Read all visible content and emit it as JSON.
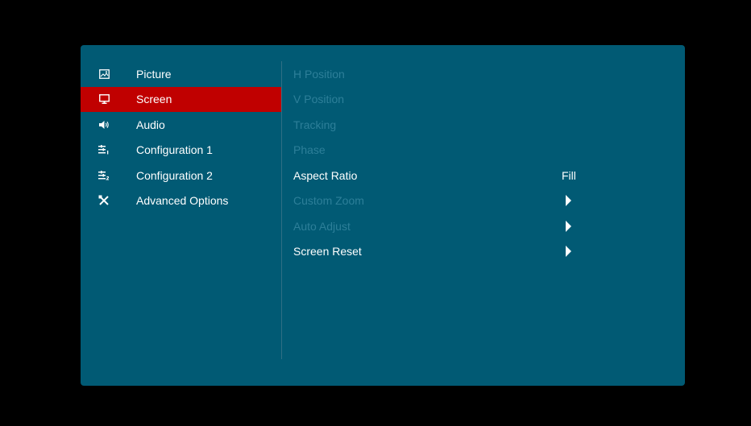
{
  "sidebar": {
    "items": [
      {
        "label": "Picture",
        "icon": "picture-icon",
        "active": false
      },
      {
        "label": "Screen",
        "icon": "monitor-icon",
        "active": true
      },
      {
        "label": "Audio",
        "icon": "speaker-icon",
        "active": false
      },
      {
        "label": "Configuration 1",
        "icon": "config-1-icon",
        "active": false
      },
      {
        "label": "Configuration 2",
        "icon": "config-2-icon",
        "active": false
      },
      {
        "label": "Advanced Options",
        "icon": "tools-icon",
        "active": false
      }
    ]
  },
  "screen_menu": {
    "rows": [
      {
        "label": "H Position",
        "enabled": false,
        "value": "",
        "has_arrow": false
      },
      {
        "label": "V Position",
        "enabled": false,
        "value": "",
        "has_arrow": false
      },
      {
        "label": "Tracking",
        "enabled": false,
        "value": "",
        "has_arrow": false
      },
      {
        "label": "Phase",
        "enabled": false,
        "value": "",
        "has_arrow": false
      },
      {
        "label": "Aspect Ratio",
        "enabled": true,
        "value": "Fill",
        "has_arrow": false
      },
      {
        "label": "Custom Zoom",
        "enabled": false,
        "value": "",
        "has_arrow": true
      },
      {
        "label": "Auto Adjust",
        "enabled": false,
        "value": "",
        "has_arrow": true
      },
      {
        "label": "Screen Reset",
        "enabled": true,
        "value": "",
        "has_arrow": true
      }
    ]
  },
  "colors": {
    "panel_bg": "#015a74",
    "active_bg": "#c00000",
    "enabled_text": "#ffffff",
    "disabled_text": "#2d7f99",
    "outer_bg": "#000000"
  }
}
